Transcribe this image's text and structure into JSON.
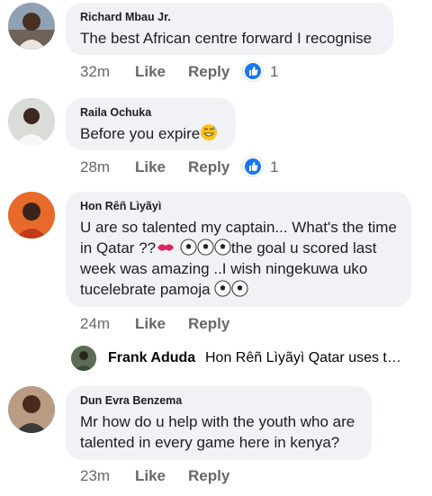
{
  "comments": [
    {
      "author": "Richard Mbau Jr.",
      "lines": [
        "The best African centre forward I recognise"
      ],
      "time": "32m",
      "like": "Like",
      "reply": "Reply",
      "reaction": "like-reaction-icon",
      "reaction_count": "1"
    },
    {
      "author": "Raila Ochuka",
      "lines": [
        "Before you expire"
      ],
      "emoji_after": "grinning-sweat-emoji",
      "time": "28m",
      "like": "Like",
      "reply": "Reply",
      "reaction": "like-reaction-icon",
      "reaction_count": "1"
    },
    {
      "author": "Hon Rêñ Lìyãyì",
      "lines": [
        "U are so talented my captain... What's the time",
        "in Qatar ??",
        "week was amazing ..I wish ningekuwa uko",
        "tucelebrate pamoja"
      ],
      "line2_tail": "the goal u scored last",
      "emojis": [
        "kiss-mark-emoji",
        "soccer-ball-emoji"
      ],
      "time": "24m",
      "like": "Like",
      "reply": "Reply"
    },
    {
      "author": "Dun Evra Benzema",
      "lines": [
        "Mr how do u help with the youth who are",
        "talented in every game here in kenya?"
      ],
      "time": "23m",
      "like": "Like",
      "reply": "Reply"
    }
  ],
  "reply_preview": {
    "name": "Frank Aduda",
    "text": "Hon Rêñ Lìyãyì Qatar uses t…"
  },
  "colors": {
    "bubble": "#f0f2f5",
    "meta_text": "#65676b",
    "like_blue": "#1877f2"
  }
}
